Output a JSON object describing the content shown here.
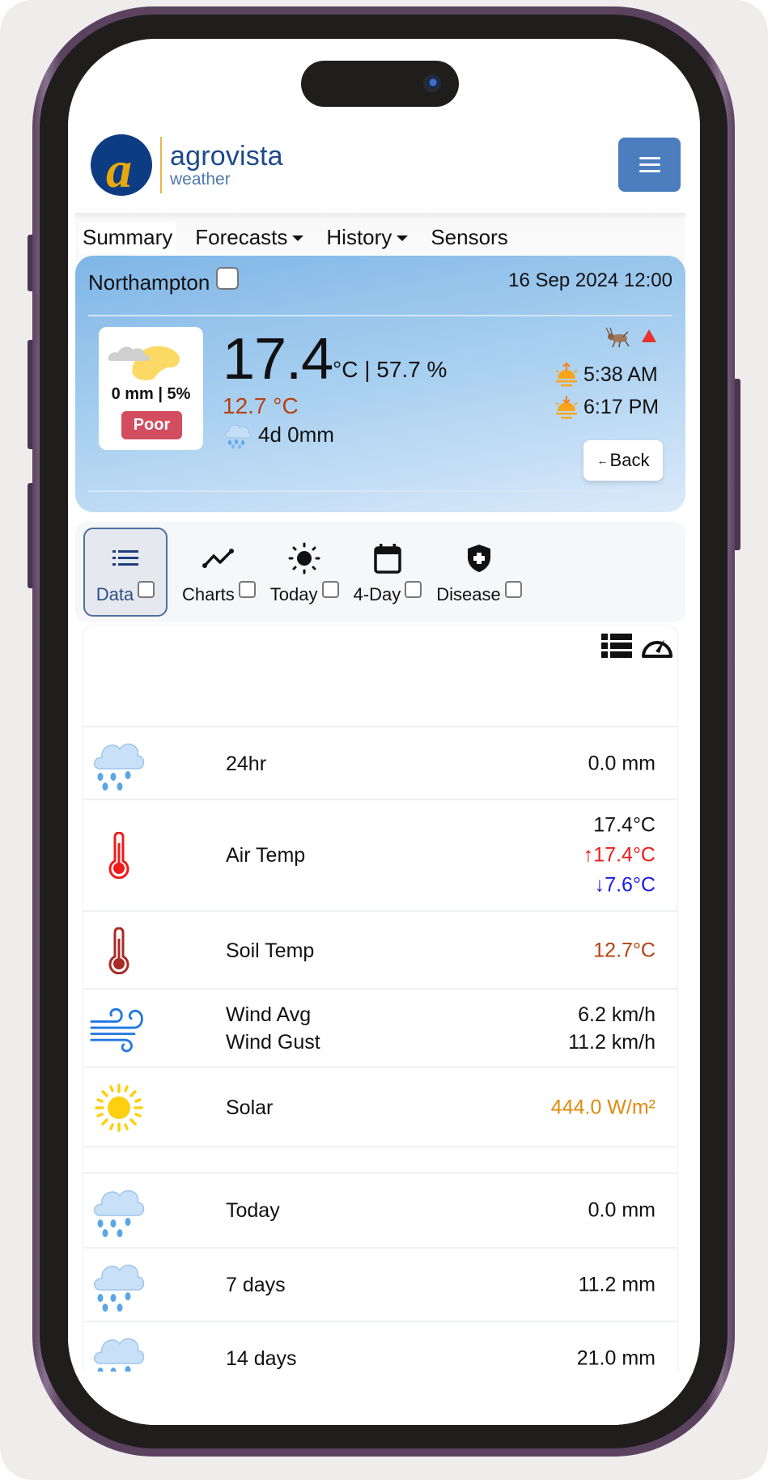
{
  "app": {
    "brand": "agrovista",
    "brand_sub": "weather",
    "menu_icon": "hamburger-icon"
  },
  "nav": {
    "items": [
      {
        "label": "Summary",
        "dropdown": false,
        "active": true
      },
      {
        "label": "Forecasts",
        "dropdown": true
      },
      {
        "label": "History",
        "dropdown": true
      },
      {
        "label": "Sensors",
        "dropdown": false
      }
    ]
  },
  "summary": {
    "location": "Northampton",
    "datetime": "16 Sep 2024 12:00",
    "forecast_icon": "partly-cloudy-icon",
    "forecast_stat": "0 mm | 5%",
    "spray_condition": "Poor",
    "air_temp": "17.4",
    "temp_humidity_suffix": "°C | 57.7 %",
    "soil_temp": "12.7 °C",
    "rain_forecast": "4d 0mm",
    "sunrise": "5:38 AM",
    "sunset": "6:17 PM",
    "back_label": "Back",
    "colors": {
      "soil_temp": "#b6410f",
      "badge": "#d24d5f",
      "alert": "#e8322b"
    }
  },
  "tabs": [
    {
      "label": "Data",
      "icon": "list-icon",
      "active": true
    },
    {
      "label": "Charts",
      "icon": "line-chart-icon"
    },
    {
      "label": "Today",
      "icon": "sun-icon"
    },
    {
      "label": "4-Day",
      "icon": "calendar-icon"
    },
    {
      "label": "Disease",
      "icon": "shield-plus-icon"
    }
  ],
  "data_rows": {
    "rain24": {
      "label": "24hr",
      "value": "0.0 mm",
      "icon": "rain-cloud-icon"
    },
    "air_temp": {
      "label": "Air Temp",
      "current": "17.4°C",
      "max_arrow": "↑",
      "max": "17.4°C",
      "min_arrow": "↓",
      "min": "7.6°C",
      "icon": "thermometer-icon"
    },
    "soil_temp": {
      "label": "Soil Temp",
      "value": "12.7°C",
      "icon": "thermometer-icon"
    },
    "wind": {
      "avg_label": "Wind Avg",
      "gust_label": "Wind Gust",
      "avg": "6.2 km/h",
      "gust": "11.2 km/h",
      "icon": "wind-icon"
    },
    "solar": {
      "label": "Solar",
      "value": "444.0 W/m²",
      "icon": "sun-icon"
    },
    "rain_today": {
      "label": "Today",
      "value": "0.0 mm",
      "icon": "rain-cloud-icon"
    },
    "rain_7": {
      "label": "7 days",
      "value": "11.2 mm",
      "icon": "rain-cloud-icon"
    },
    "rain_14": {
      "label": "14 days",
      "value": "21.0 mm",
      "icon": "rain-cloud-icon"
    }
  }
}
